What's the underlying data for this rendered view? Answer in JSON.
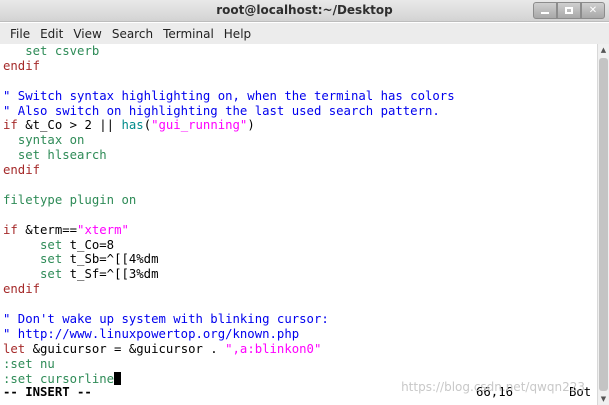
{
  "window": {
    "title": "root@localhost:~/Desktop"
  },
  "menu": {
    "items": [
      "File",
      "Edit",
      "View",
      "Search",
      "Terminal",
      "Help"
    ]
  },
  "editor": {
    "lines": [
      [
        {
          "t": "   "
        },
        {
          "t": "set csverb",
          "c": "ty"
        }
      ],
      [
        {
          "t": "endif",
          "c": "kw"
        }
      ],
      [
        {
          "t": ""
        }
      ],
      [
        {
          "t": "\" Switch syntax highlighting on, when the terminal has colors",
          "c": "cm"
        }
      ],
      [
        {
          "t": "\" Also switch on highlighting the last used search pattern.",
          "c": "cm"
        }
      ],
      [
        {
          "t": "if",
          "c": "kw"
        },
        {
          "t": " &t_Co > 2 || "
        },
        {
          "t": "has",
          "c": "cyan"
        },
        {
          "t": "("
        },
        {
          "t": "\"gui_running\"",
          "c": "st"
        },
        {
          "t": ")"
        }
      ],
      [
        {
          "t": "  "
        },
        {
          "t": "syntax on",
          "c": "ty"
        }
      ],
      [
        {
          "t": "  "
        },
        {
          "t": "set hlsearch",
          "c": "ty"
        }
      ],
      [
        {
          "t": "endif",
          "c": "kw"
        }
      ],
      [
        {
          "t": ""
        }
      ],
      [
        {
          "t": "filetype plugin on",
          "c": "ty"
        }
      ],
      [
        {
          "t": ""
        }
      ],
      [
        {
          "t": "if",
          "c": "kw"
        },
        {
          "t": " &term=="
        },
        {
          "t": "\"xterm\"",
          "c": "st"
        }
      ],
      [
        {
          "t": "     "
        },
        {
          "t": "set",
          "c": "ty"
        },
        {
          "t": " t_Co=8"
        }
      ],
      [
        {
          "t": "     "
        },
        {
          "t": "set",
          "c": "ty"
        },
        {
          "t": " t_Sb=^[[4%dm"
        }
      ],
      [
        {
          "t": "     "
        },
        {
          "t": "set",
          "c": "ty"
        },
        {
          "t": " t_Sf=^[[3%dm"
        }
      ],
      [
        {
          "t": "endif",
          "c": "kw"
        }
      ],
      [
        {
          "t": ""
        }
      ],
      [
        {
          "t": "\" Don't wake up system with blinking cursor:",
          "c": "cm"
        }
      ],
      [
        {
          "t": "\" http://www.linuxpowertop.org/known.php",
          "c": "cm"
        }
      ],
      [
        {
          "t": "let",
          "c": "kw"
        },
        {
          "t": " &guicursor = &guicursor . "
        },
        {
          "t": "\",a:blinkon0\"",
          "c": "st"
        }
      ],
      [
        {
          "t": ":set nu",
          "c": "ty"
        }
      ],
      [
        {
          "t": ":set cursorline",
          "c": "ty"
        },
        {
          "t": "",
          "cursor": true
        }
      ]
    ],
    "status": {
      "mode": "-- INSERT --",
      "position": "66,16",
      "scroll": "Bot"
    }
  },
  "watermark": "https://blog.csdn.net/qwqn223",
  "icons": {
    "minimize": "minimize-icon",
    "maximize": "maximize-icon",
    "close": "close-icon"
  }
}
